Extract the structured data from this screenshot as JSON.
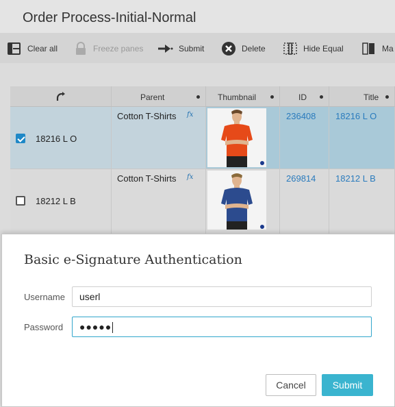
{
  "page": {
    "title": "Order Process-Initial-Normal"
  },
  "toolbar": {
    "clear_all": "Clear all",
    "freeze_panes": "Freeze panes",
    "submit": "Submit",
    "delete": "Delete",
    "hide_equal": "Hide Equal",
    "truncated_item": "Ma"
  },
  "grid": {
    "columns": [
      {
        "key": "select",
        "icon": "pin-rotate-icon"
      },
      {
        "key": "parent",
        "label": "Parent"
      },
      {
        "key": "thumbnail",
        "label": "Thumbnail"
      },
      {
        "key": "id",
        "label": "ID"
      },
      {
        "key": "title",
        "label": "Title"
      }
    ],
    "rows": [
      {
        "selected": true,
        "name": "18216 L O",
        "parent": "Cotton T-Shirts",
        "fx": "fx",
        "thumbnail": "tshirt-orange-image",
        "shirt_color": "#e64a19",
        "id": "236408",
        "title": "18216 L O"
      },
      {
        "selected": false,
        "name": "18212 L B",
        "parent": "Cotton T-Shirts",
        "fx": "fx",
        "thumbnail": "tshirt-blue-image",
        "shirt_color": "#2c4b8e",
        "id": "269814",
        "title": "18212 L B"
      }
    ]
  },
  "dialog": {
    "title": "Basic e-Signature Authentication",
    "username_label": "Username",
    "username_value": "userl",
    "password_label": "Password",
    "password_value": "●●●●●",
    "cancel_label": "Cancel",
    "submit_label": "Submit"
  },
  "colors": {
    "accent": "#3ab4cf",
    "link": "#2a7bbd",
    "selected_row": "#a9c9d8"
  }
}
